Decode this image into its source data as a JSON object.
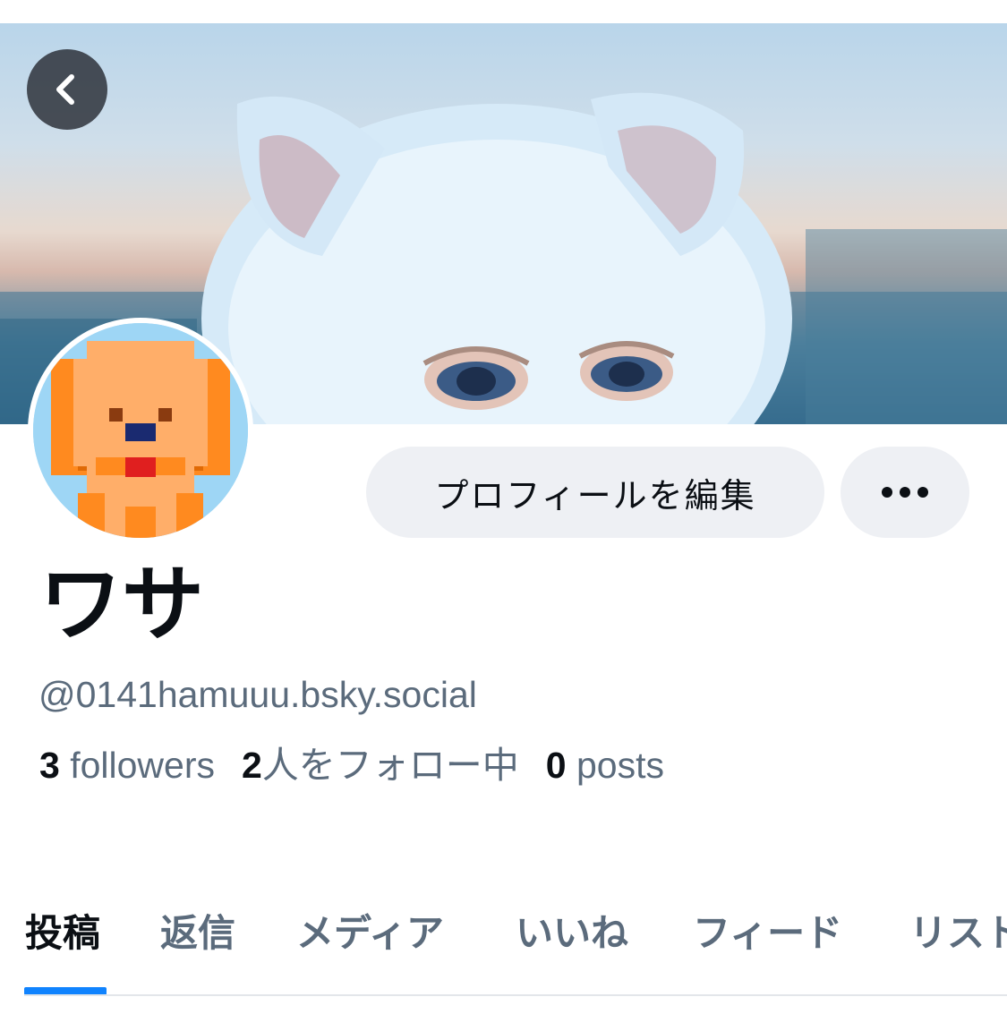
{
  "profile": {
    "display_name": "ワサ",
    "handle": "@0141hamuuu.bsky.social",
    "stats": {
      "followers_count": "3",
      "followers_label": " followers",
      "following_count": "2",
      "following_label": "人をフォロー中",
      "posts_count": "0",
      "posts_label": " posts"
    }
  },
  "actions": {
    "edit_profile_label": "プロフィールを編集",
    "more_icon": "ellipsis-icon",
    "back_icon": "chevron-left-icon"
  },
  "tabs": [
    {
      "label": "投稿",
      "active": true
    },
    {
      "label": "返信",
      "active": false
    },
    {
      "label": "メディア",
      "active": false
    },
    {
      "label": "いいね",
      "active": false
    },
    {
      "label": "フィード",
      "active": false
    },
    {
      "label": "リスト",
      "active": false
    }
  ],
  "colors": {
    "accent": "#1083fe",
    "text_primary": "#0b0f14",
    "text_secondary": "#5b6b7c",
    "button_bg": "#eef0f4"
  }
}
